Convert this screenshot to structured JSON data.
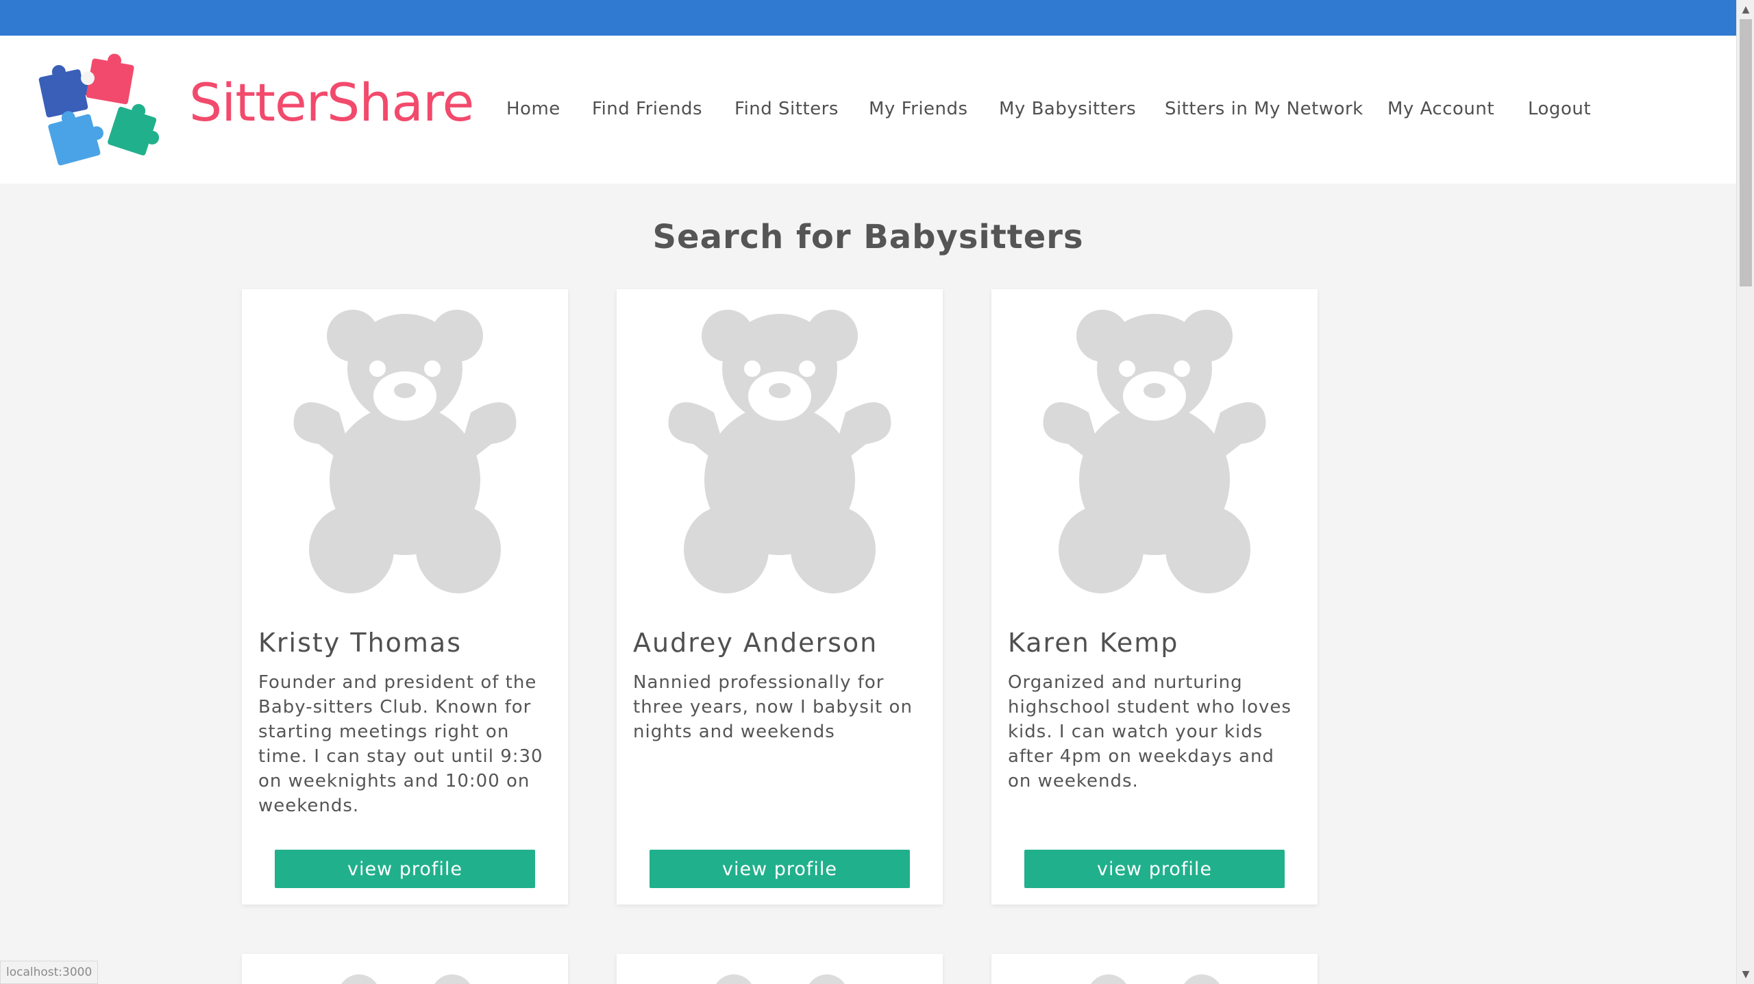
{
  "brand": {
    "name": "SitterShare",
    "colors": {
      "pink": "#f24a6c",
      "blue_top_bar": "#307ad2",
      "teal_button": "#21b08c"
    }
  },
  "nav": {
    "items": [
      {
        "label": "Home"
      },
      {
        "label": "Find Friends"
      },
      {
        "label": "Find Sitters"
      },
      {
        "label": "My Friends"
      },
      {
        "label": "My Babysitters"
      },
      {
        "label": "Sitters in My Network"
      },
      {
        "label": "My Account"
      },
      {
        "label": "Logout"
      }
    ]
  },
  "page": {
    "title": "Search for Babysitters"
  },
  "sitters": [
    {
      "name": "Kristy Thomas",
      "bio": "Founder and president of the Baby-sitters Club. Known for starting meetings right on time. I can stay out until 9:30 on weeknights and 10:00 on weekends.",
      "button_label": "view profile",
      "avatar_icon": "teddy-bear-icon"
    },
    {
      "name": "Audrey Anderson",
      "bio": "Nannied professionally for three years, now I babysit on nights and weekends",
      "button_label": "view profile",
      "avatar_icon": "teddy-bear-icon"
    },
    {
      "name": "Karen Kemp",
      "bio": "Organized and nurturing highschool student who loves kids. I can watch your kids after 4pm on weekdays and on weekends.",
      "button_label": "view profile",
      "avatar_icon": "teddy-bear-icon"
    }
  ],
  "status_bar": {
    "url": "localhost:3000"
  }
}
